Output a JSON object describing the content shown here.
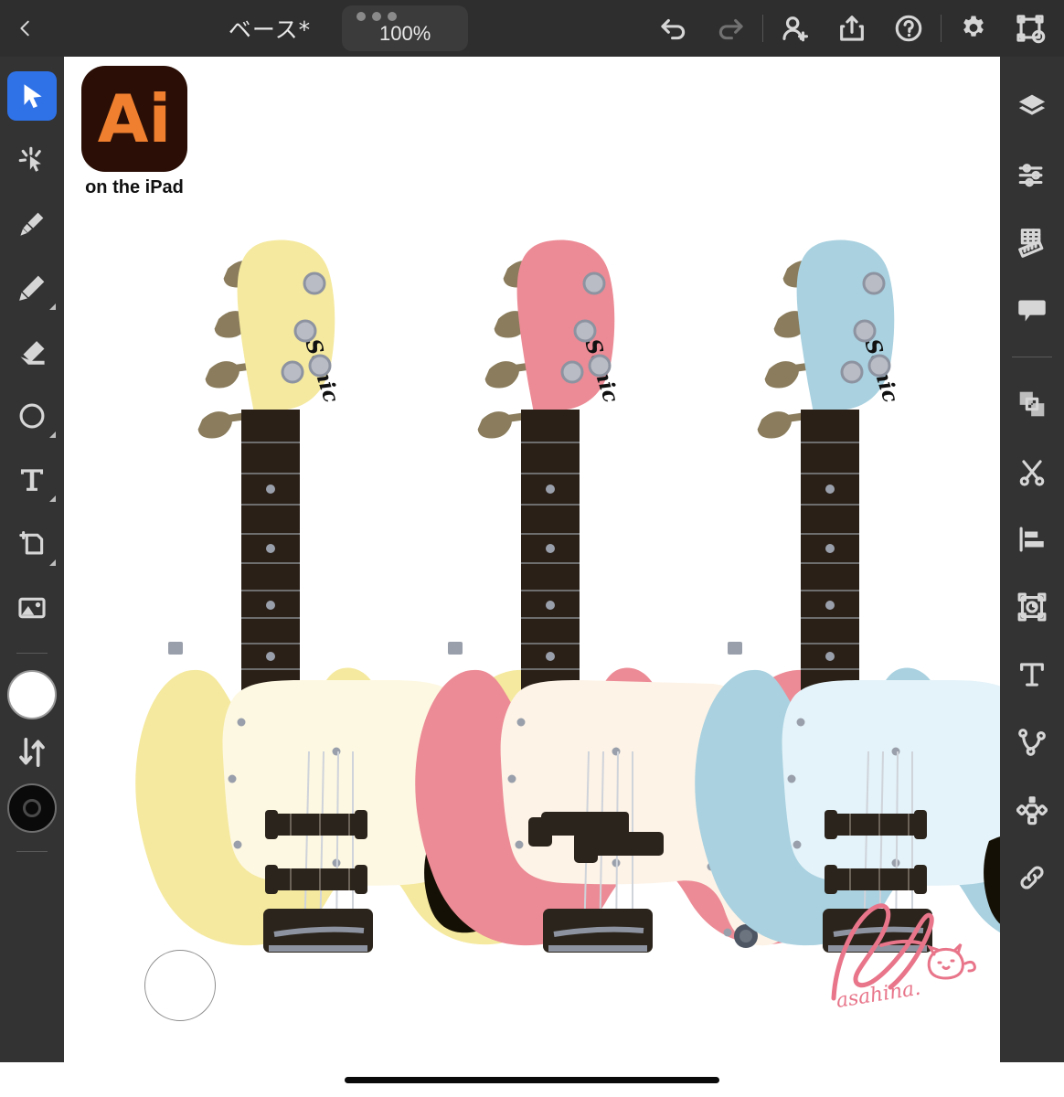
{
  "app": {
    "name": "Adobe Illustrator on the iPad",
    "platform": "iPad"
  },
  "topbar": {
    "back_label": "back-chevron",
    "document_title": "ベース*",
    "zoom_level": "100%",
    "zoom_dots": 3,
    "actions": [
      {
        "name": "undo",
        "label": "Undo",
        "enabled": true
      },
      {
        "name": "redo",
        "label": "Redo",
        "enabled": false
      },
      {
        "name": "invite",
        "label": "Invite",
        "enabled": true
      },
      {
        "name": "share",
        "label": "Share / Export",
        "enabled": true
      },
      {
        "name": "help",
        "label": "Help",
        "enabled": true
      },
      {
        "name": "settings",
        "label": "Settings",
        "enabled": true
      },
      {
        "name": "preview",
        "label": "View / Preview",
        "enabled": true
      }
    ]
  },
  "left_toolbar": {
    "tools": [
      {
        "name": "selection-tool",
        "label": "Selection",
        "active": true,
        "has_flyout": false
      },
      {
        "name": "direct-selection-tool",
        "label": "Direct Selection / Magic Wand",
        "active": false,
        "has_flyout": false
      },
      {
        "name": "pen-tool",
        "label": "Pen",
        "active": false,
        "has_flyout": false
      },
      {
        "name": "pencil-tool",
        "label": "Pencil",
        "active": false,
        "has_flyout": true
      },
      {
        "name": "eraser-tool",
        "label": "Eraser",
        "active": false,
        "has_flyout": false
      },
      {
        "name": "shape-tool",
        "label": "Shape",
        "active": false,
        "has_flyout": true
      },
      {
        "name": "type-tool",
        "label": "Type",
        "active": false,
        "has_flyout": true
      },
      {
        "name": "artboard-tool",
        "label": "Artboard / Crop",
        "active": false,
        "has_flyout": true
      },
      {
        "name": "image-tool",
        "label": "Place Image",
        "active": false,
        "has_flyout": false
      }
    ],
    "fill_color": "#ffffff",
    "stroke_color": "#000000",
    "swap_label": "Swap fill and stroke"
  },
  "right_toolbar": {
    "items": [
      {
        "name": "layers-panel",
        "label": "Layers"
      },
      {
        "name": "properties-panel",
        "label": "Properties"
      },
      {
        "name": "grid-ruler",
        "label": "Grid & Ruler"
      },
      {
        "name": "comments-panel",
        "label": "Comments"
      },
      {
        "name": "arrange-combine",
        "label": "Arrange / Combine Shapes"
      },
      {
        "name": "scissors-tool",
        "label": "Scissors"
      },
      {
        "name": "align-panel",
        "label": "Align"
      },
      {
        "name": "transform-panel",
        "label": "Transform"
      },
      {
        "name": "text-panel",
        "label": "Text"
      },
      {
        "name": "path-panel",
        "label": "Path / Curve"
      },
      {
        "name": "repeat-panel",
        "label": "Repeat"
      },
      {
        "name": "link-panel",
        "label": "Link"
      }
    ]
  },
  "canvas": {
    "background": "#ffffff",
    "badge": {
      "logo_text": "Ai",
      "caption": "on the iPad",
      "bg_color": "#2b0f06",
      "text_color": "#f08030"
    },
    "artwork": {
      "title": "Three bass guitars",
      "headstock_brand": "Sonic",
      "signature_text": "asahina.",
      "signature_color": "#e8758a",
      "guitars": [
        {
          "name": "yellow-jazz-bass",
          "body_color": "#f5e99f",
          "pickguard_color": "#fdf8e2",
          "type": "jazz",
          "strings": 4
        },
        {
          "name": "pink-precision-bass",
          "body_color": "#ec8b95",
          "pickguard_color": "#fdf3e7",
          "type": "precision",
          "strings": 4
        },
        {
          "name": "blue-jazz-bass",
          "body_color": "#a9d1e0",
          "pickguard_color": "#e4f3f9",
          "type": "jazz",
          "strings": 4
        }
      ],
      "fretboard_color": "#2b2018",
      "tuner_color": "#8a7c5c",
      "hardware_color": "#8d93a0"
    },
    "empty_circle_label": "Unfilled circle path"
  },
  "homebar": {
    "label": "Home indicator"
  }
}
